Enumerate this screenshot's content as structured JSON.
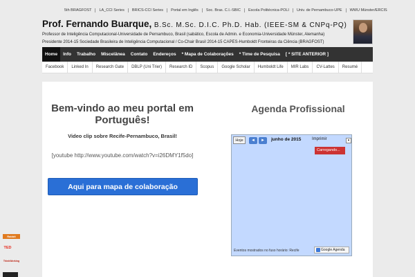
{
  "top_links": [
    "5th BRAGFOST",
    "LA_CCI Series",
    "BRICS-CCI Series",
    "Portal em Inglês",
    "Soc. Bras. C.I.-SBIC",
    "Escola Politécnica-POLI",
    "Univ. de Pernambuco-UPE",
    "WWU Münster/ERCIS"
  ],
  "header": {
    "name": "Prof. Fernando Buarque,",
    "degrees": "B.Sc.  M.Sc.  D.I.C.  Ph.D.  Hab.",
    "affiliation": "(IEEE-SM & CNPq-PQ)",
    "description_line1": "Professor de Inteligência Computacional-Universidade de Pernambuco, Brasil  (sabático, Escola de Admin. e Economia-Universidade Münster, Alemanha)",
    "description_line2": "Presidente 2014-15 Sociedade Brasileira de Inteligência Computacional  /  Co-Chair Brasil 2014-15 CAPES-Humboldt Fronteiras da Ciência (BRAGFOST)"
  },
  "main_nav": [
    "Home",
    "Info",
    "Trabalho",
    "Miscelânea",
    "Contato",
    "Endereços",
    "* Mapa de Colaborações",
    "* Time de Pesquisa",
    "[ * SITE ANTERIOR ]"
  ],
  "sub_nav": [
    "Facebook",
    "Linked In",
    "Research Gate",
    "DBLP (Uni Trier)",
    "Research ID",
    "Scopus",
    "Google Scholar",
    "Humboldt Life",
    "MIR Labs",
    "CV-Lattes",
    "Resumé"
  ],
  "content": {
    "welcome": "Bem-vindo ao meu portal em Português!",
    "video_title": "Video clip sobre Recife-Pernambuco, Brasil!",
    "youtube_code": "[youtube http://www.youtube.com/watch?v=i26DMY1f5do]",
    "map_button": "Aqui para mapa de colaboração"
  },
  "agenda": {
    "title": "Agenda Profissional",
    "today_label": "Hoje",
    "prev_arrow": "◄",
    "next_arrow": "►",
    "month": "junho de 2015",
    "print_label": "Imprimir",
    "dropdown_arrow": "▾",
    "loading": "Carregando...",
    "timezone": "Eventos mostrados no fuso horário: Recife",
    "gagenda": "Google Agenda"
  },
  "side_badges": {
    "rabbit": "Rabbit",
    "ted": "TED",
    "thinking": "ThinkWorking"
  }
}
